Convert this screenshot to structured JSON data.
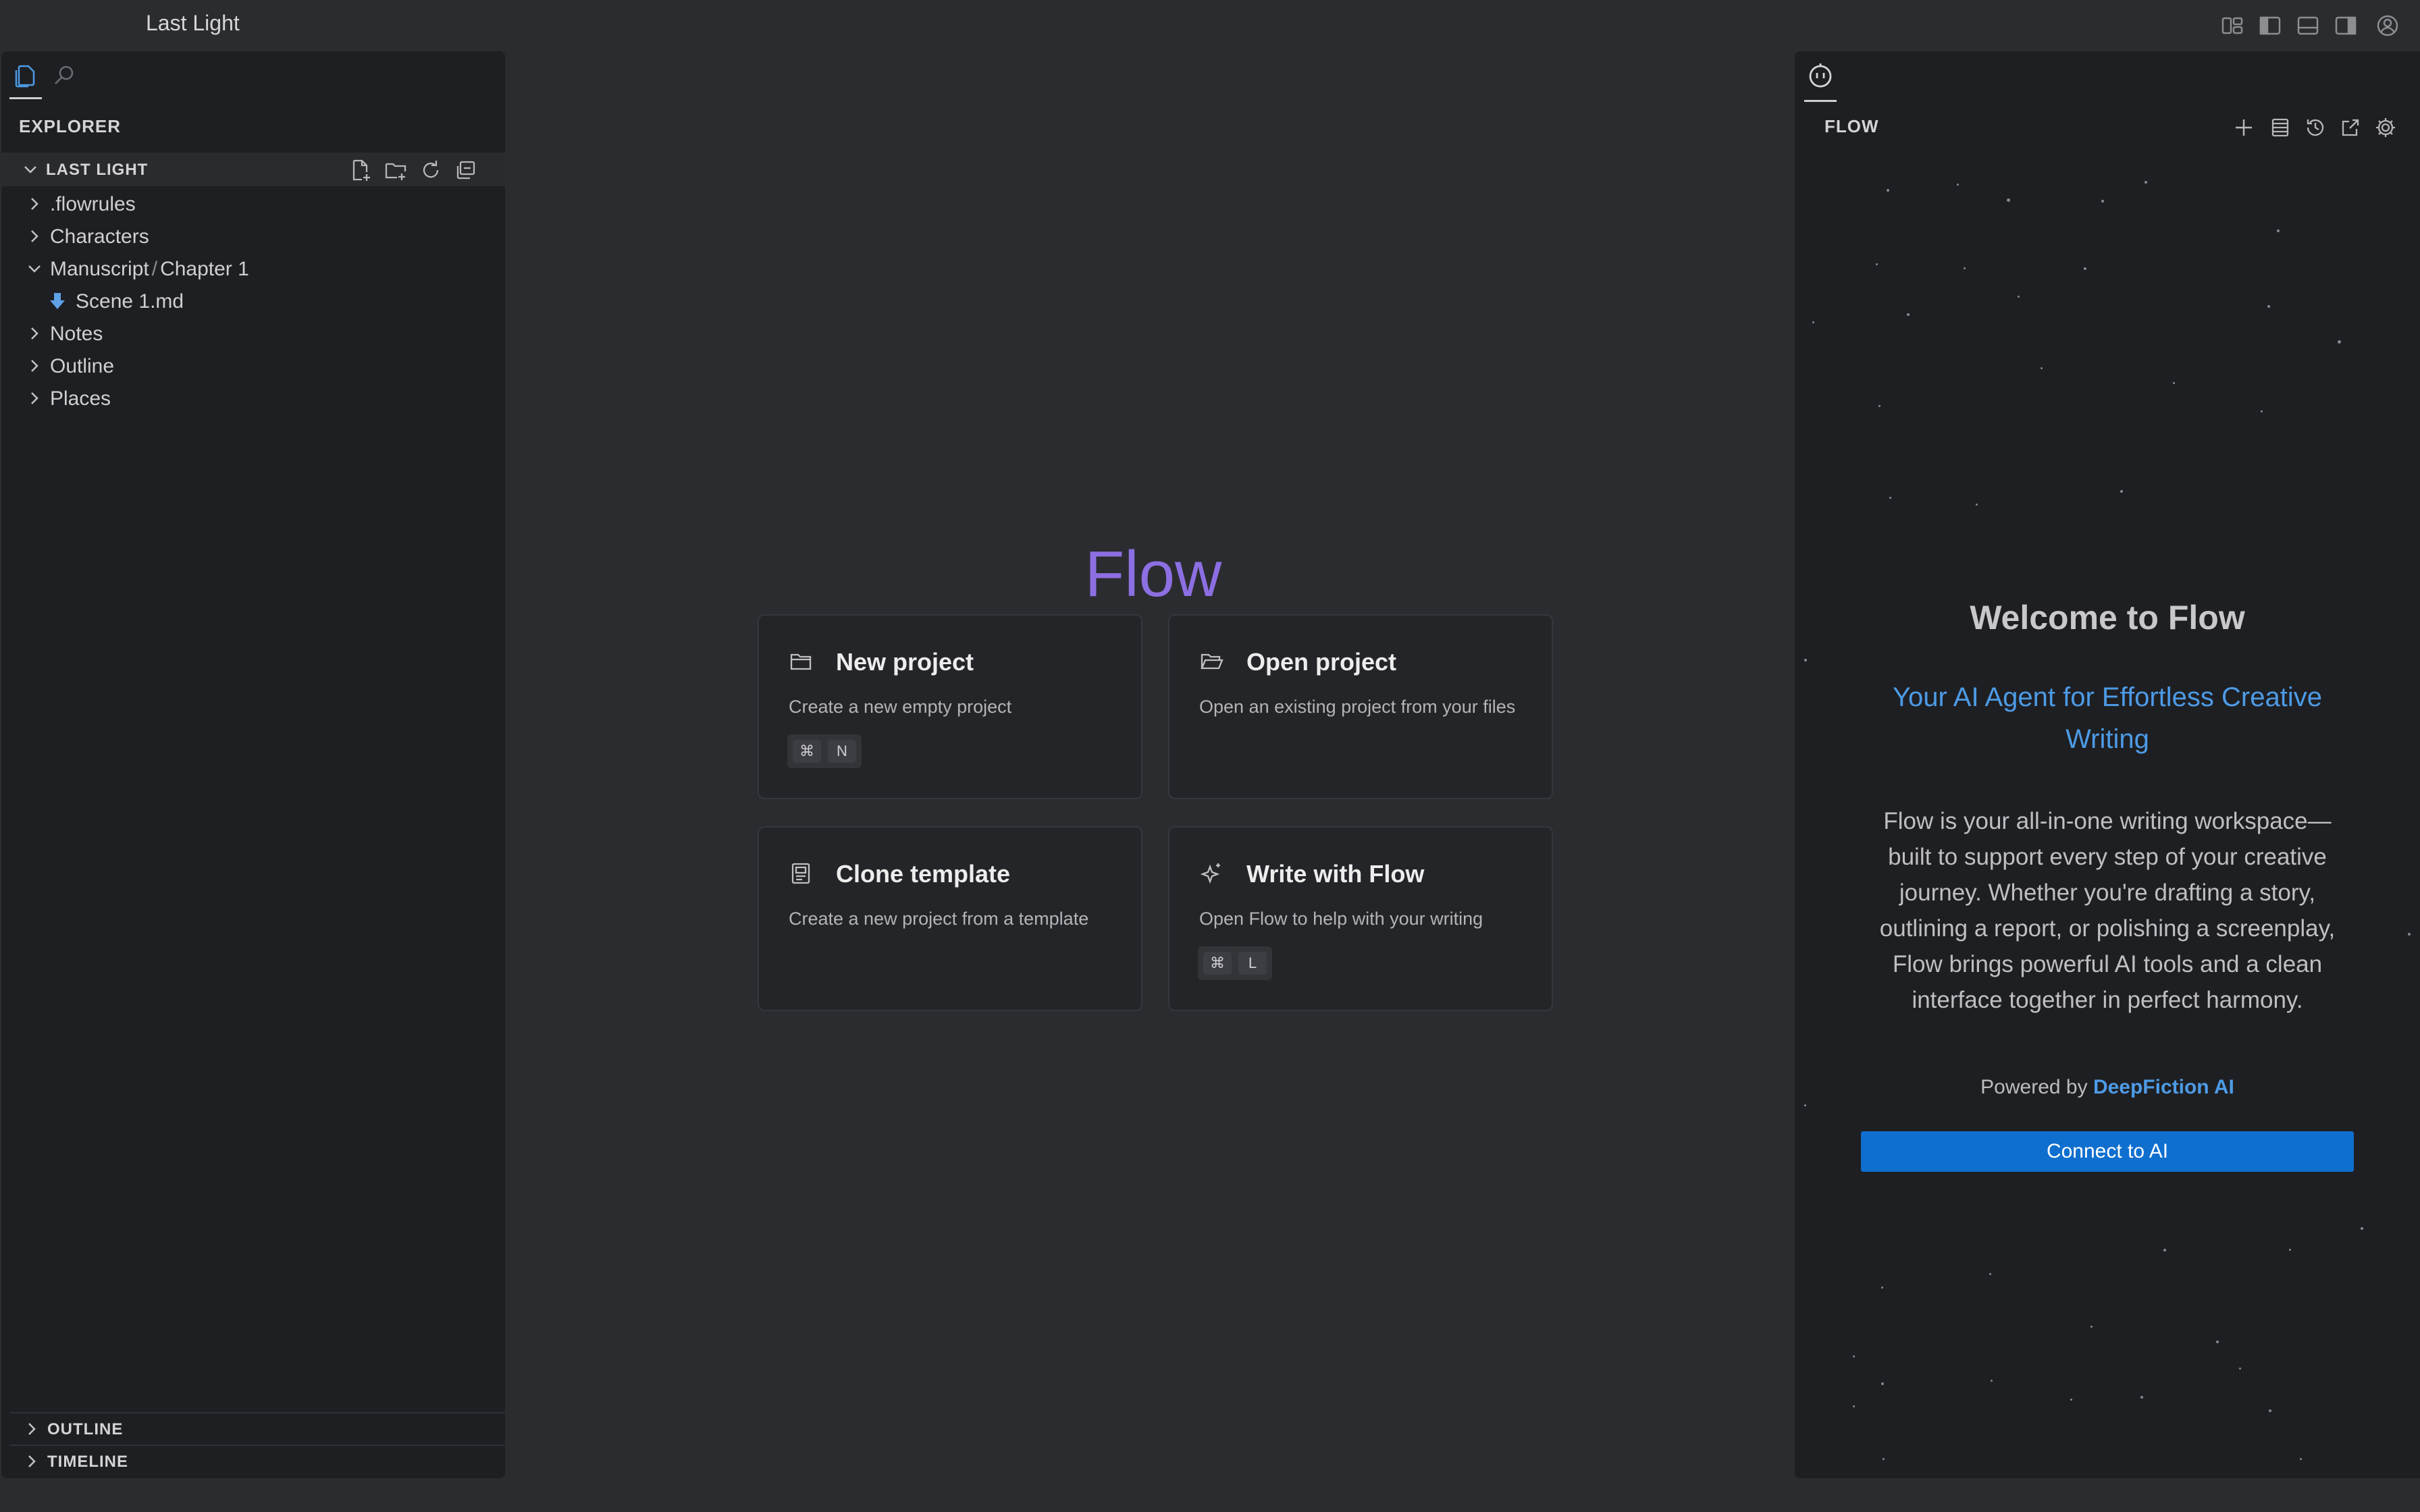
{
  "titlebar": {
    "title": "Last Light",
    "icons": [
      "customize-layout-icon",
      "toggle-primary-sidebar-icon",
      "toggle-panel-icon",
      "toggle-secondary-sidebar-icon",
      "account-icon"
    ]
  },
  "sidebar": {
    "activity_icons": [
      "explorer-icon",
      "search-icon"
    ],
    "explorer_title": "EXPLORER",
    "folder": {
      "name": "LAST LIGHT",
      "actions": [
        "new-file-icon",
        "new-folder-icon",
        "refresh-icon",
        "collapse-all-icon"
      ]
    },
    "tree": [
      {
        "label": ".flowrules",
        "expanded": false
      },
      {
        "label": "Characters",
        "expanded": false
      },
      {
        "label": "Manuscript",
        "sub": "Chapter 1",
        "expanded": true
      },
      {
        "label": "Scene 1.md",
        "file": true
      },
      {
        "label": "Notes",
        "expanded": false
      },
      {
        "label": "Outline",
        "expanded": false
      },
      {
        "label": "Places",
        "expanded": false
      }
    ],
    "sections": {
      "outline": "OUTLINE",
      "timeline": "TIMELINE"
    }
  },
  "center": {
    "title": "Flow",
    "cards": [
      {
        "title": "New project",
        "description": "Create a new empty project",
        "keys": [
          "⌘",
          "N"
        ],
        "icon": "folder-icon"
      },
      {
        "title": "Open project",
        "description": "Open an existing project from your files",
        "icon": "folder-open-icon"
      },
      {
        "title": "Clone template",
        "description": "Create a new project from a template",
        "icon": "template-icon"
      },
      {
        "title": "Write with Flow",
        "description": "Open Flow to help with your writing",
        "keys": [
          "⌘",
          "L"
        ],
        "icon": "sparkle-icon"
      }
    ]
  },
  "flow_panel": {
    "title": "FLOW",
    "header_icons": [
      "new-chat-icon",
      "chat-list-icon",
      "history-icon",
      "open-external-icon",
      "settings-gear-icon"
    ],
    "welcome": "Welcome to Flow",
    "tagline": "Your AI Agent for Effortless Creative Writing",
    "description": "Flow is your all-in-one writing workspace—built to support every step of your creative journey. Whether you're drafting a story, outlining a report, or polishing a screenplay, Flow brings powerful AI tools and a clean interface together in perfect harmony.",
    "powered_by": "Powered by",
    "brand": "DeepFiction AI",
    "connect_label": "Connect to AI"
  },
  "colors": {
    "background": "#2b2c30",
    "panel": "#1e1f23",
    "accent_purple": "#8c6fe2",
    "accent_blue": "#4d9be6",
    "button_blue": "#0f6fcf"
  }
}
